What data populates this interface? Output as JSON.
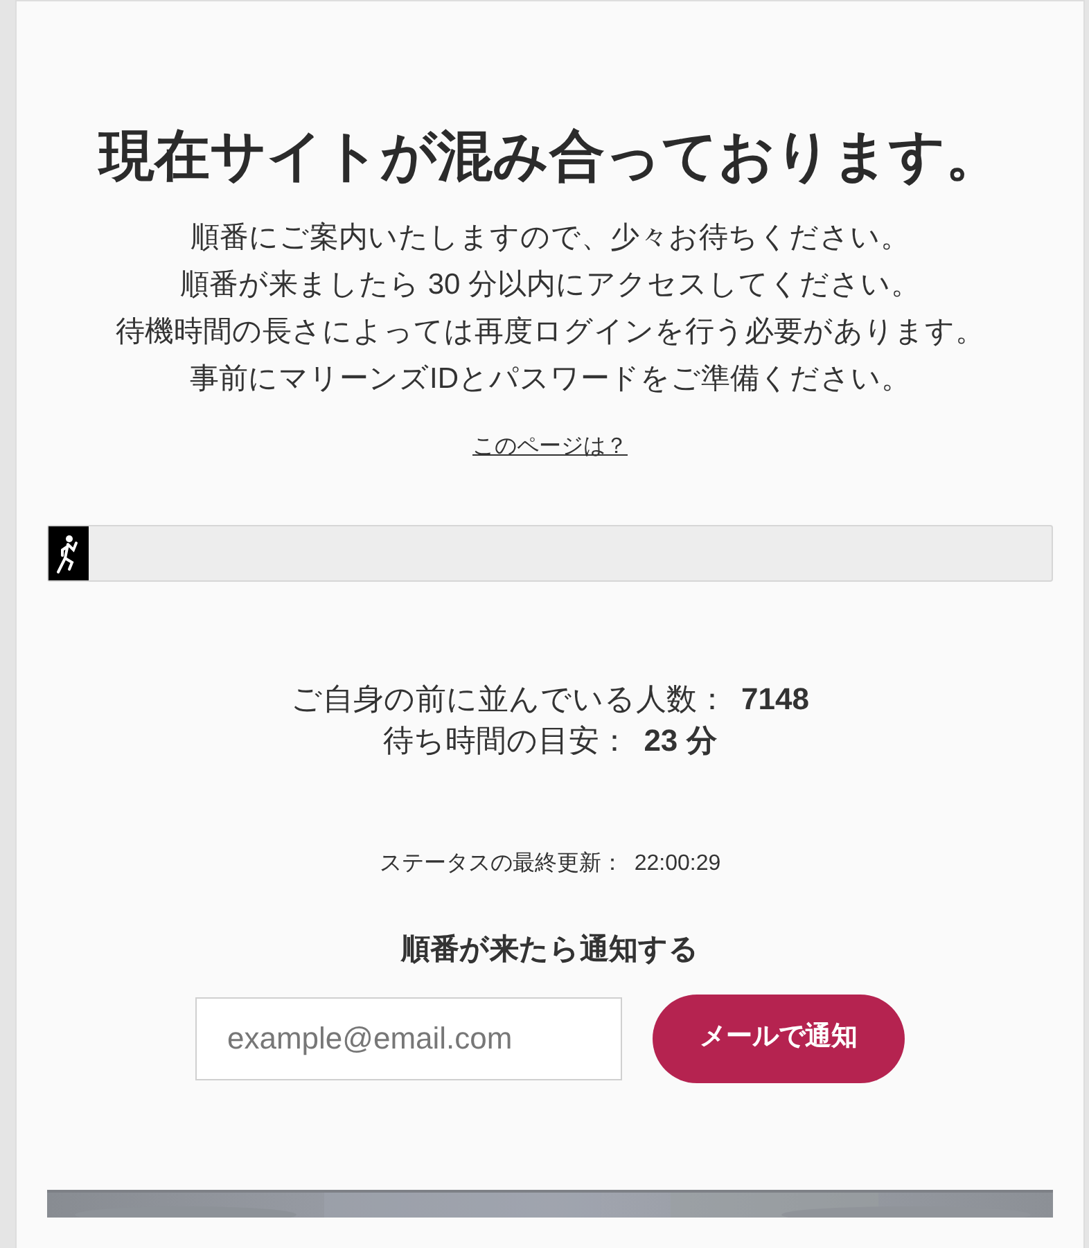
{
  "heading": "現在サイトが混み合っております。",
  "message_lines": [
    "順番にご案内いたしますので、少々お待ちください。",
    "順番が来ましたら 30 分以内にアクセスしてください。",
    "待機時間の長さによっては再度ログインを行う必要があります。",
    "事前にマリーンズIDとパスワードをご準備ください。"
  ],
  "help_link": "このページは？",
  "progress": {
    "level": 0.04
  },
  "stats": [
    {
      "label": "ご自身の前に並んでいる人数：",
      "value": "7148"
    },
    {
      "label": "待ち時間の目安：",
      "value": "23 分"
    }
  ],
  "last_update": {
    "label": "ステータスの最終更新：",
    "value": "22:00:29"
  },
  "notify": {
    "title": "順番が来たら通知する",
    "email": {
      "placeholder": "example@email.com"
    },
    "button": "メールで通知"
  }
}
